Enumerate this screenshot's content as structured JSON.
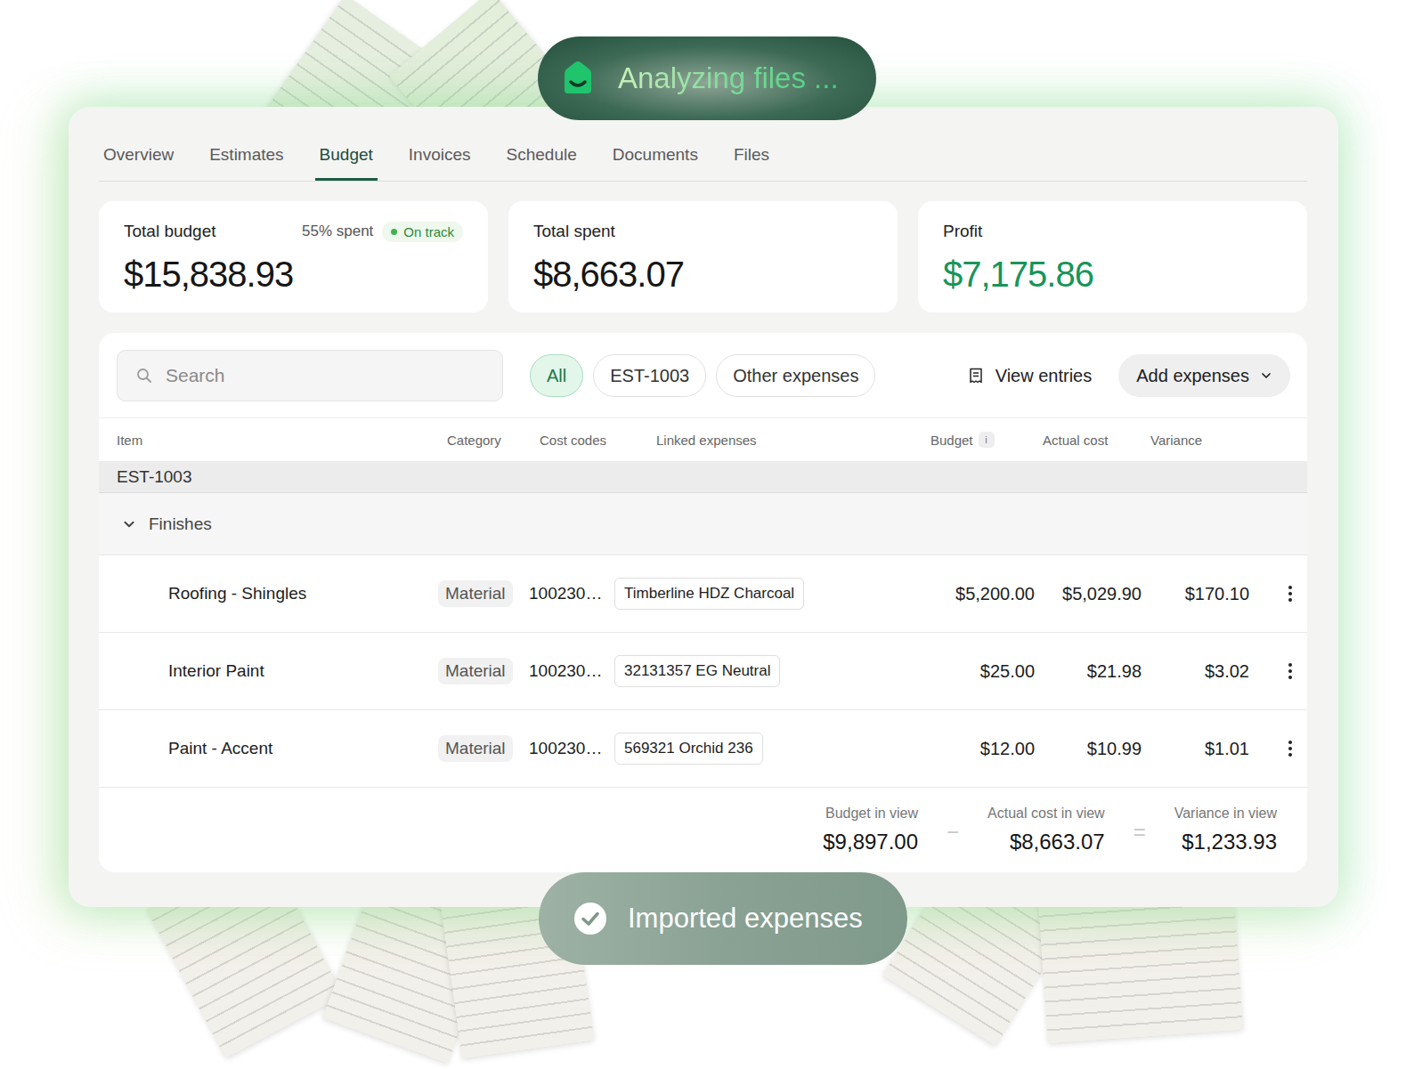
{
  "status_top": {
    "label": "Analyzing files ..."
  },
  "tabs": [
    {
      "label": "Overview",
      "selected": false
    },
    {
      "label": "Estimates",
      "selected": false
    },
    {
      "label": "Budget",
      "selected": true
    },
    {
      "label": "Invoices",
      "selected": false
    },
    {
      "label": "Schedule",
      "selected": false
    },
    {
      "label": "Documents",
      "selected": false
    },
    {
      "label": "Files",
      "selected": false
    }
  ],
  "summary": [
    {
      "label": "Total budget",
      "value": "$15,838.93",
      "percent": "55% spent",
      "status": "On track",
      "kind": "budget"
    },
    {
      "label": "Total spent",
      "value": "$8,663.07",
      "percent": "",
      "status": "",
      "kind": "plain"
    },
    {
      "label": "Profit",
      "value": "$7,175.86",
      "percent": "",
      "status": "",
      "kind": "profit"
    }
  ],
  "toolbar": {
    "search_placeholder": "Search",
    "filters": [
      {
        "label": "All",
        "selected": true
      },
      {
        "label": "EST-1003",
        "selected": false
      },
      {
        "label": "Other expenses",
        "selected": false
      }
    ],
    "view_entries": "View entries",
    "add_expenses": "Add expenses"
  },
  "table": {
    "columns": [
      "Item",
      "Category",
      "Cost codes",
      "Linked expenses",
      "Budget",
      "Actual cost",
      "Variance"
    ],
    "budget_info": "i",
    "group": "EST-1003",
    "section": {
      "name": "Finishes",
      "expanded": true
    },
    "rows": [
      {
        "item": "Roofing - Shingles",
        "category": "Material",
        "cost_code": "100230…",
        "linked": "Timberline HDZ Charcoal",
        "budget": "$5,200.00",
        "actual": "$5,029.90",
        "variance": "$170.10"
      },
      {
        "item": "Interior Paint",
        "category": "Material",
        "cost_code": "100230…",
        "linked": "32131357 EG Neutral",
        "budget": "$25.00",
        "actual": "$21.98",
        "variance": "$3.02"
      },
      {
        "item": "Paint - Accent",
        "category": "Material",
        "cost_code": "100230…",
        "linked": "569321 Orchid 236",
        "budget": "$12.00",
        "actual": "$10.99",
        "variance": "$1.01"
      }
    ]
  },
  "totals": {
    "budget": {
      "label": "Budget in view",
      "value": "$9,897.00"
    },
    "minus": "−",
    "actual": {
      "label": "Actual cost in view",
      "value": "$8,663.07"
    },
    "equals": "=",
    "variance": {
      "label": "Variance in view",
      "value": "$1,233.93"
    }
  },
  "status_bottom": {
    "label": "Imported expenses"
  }
}
